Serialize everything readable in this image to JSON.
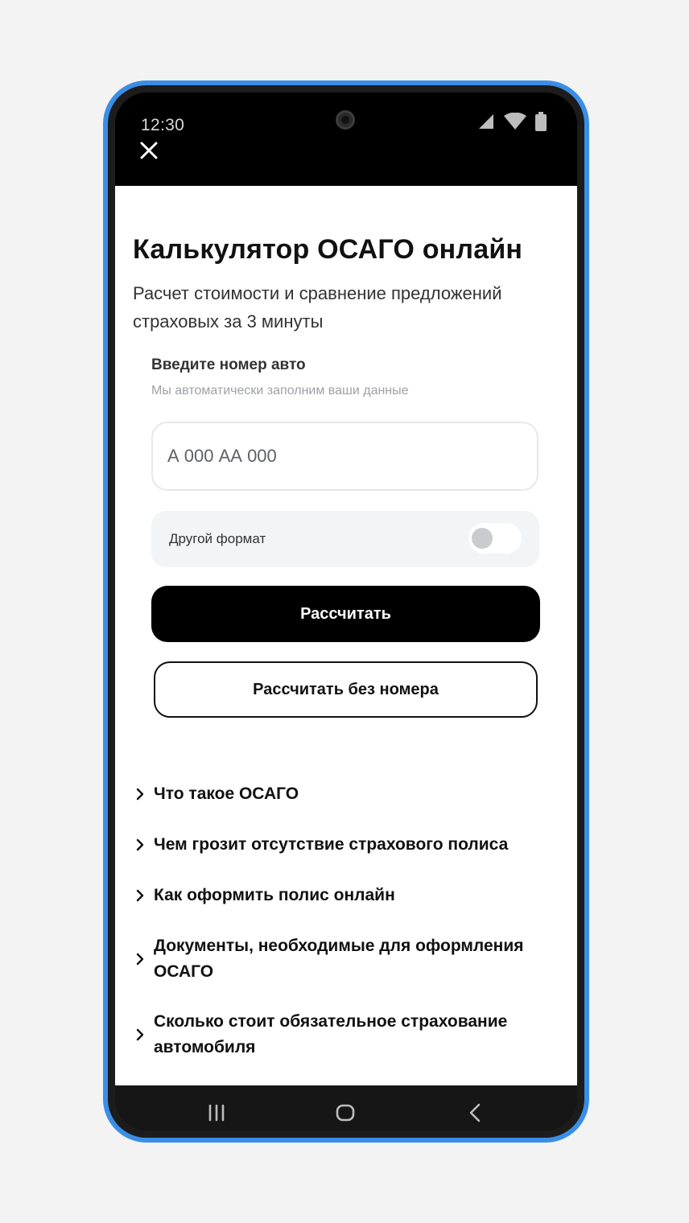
{
  "status_bar": {
    "time": "12:30",
    "icons": [
      "signal-icon",
      "wifi-icon",
      "battery-icon"
    ]
  },
  "header": {
    "close_icon": "close-icon"
  },
  "main": {
    "title": "Калькулятор ОСАГО онлайн",
    "subtitle": "Расчет стоимости и сравнение предложений страховых за 3 минуты",
    "plate_field": {
      "label": "Введите номер авто",
      "hint": "Мы автоматически заполним ваши данные",
      "placeholder": "А 000 АА 000",
      "value": ""
    },
    "other_format": {
      "label": "Другой формат",
      "enabled": false
    },
    "calculate_label": "Рассчитать",
    "calculate_without_plate_label": "Рассчитать без номера"
  },
  "faq": [
    {
      "label": "Что такое ОСАГО"
    },
    {
      "label": "Чем грозит отсутствие страхового полиса"
    },
    {
      "label": "Как оформить полис онлайн"
    },
    {
      "label": "Документы, необходимые для оформления ОСАГО"
    },
    {
      "label": "Сколько стоит обязательное страхование автомобиля"
    }
  ],
  "nav_bar": {
    "icons": [
      "recent-apps-icon",
      "home-icon",
      "back-icon"
    ]
  },
  "colors": {
    "frame": "#3a8ee6",
    "primary_button": "#000000",
    "toggle_off": "#c9cbce"
  }
}
